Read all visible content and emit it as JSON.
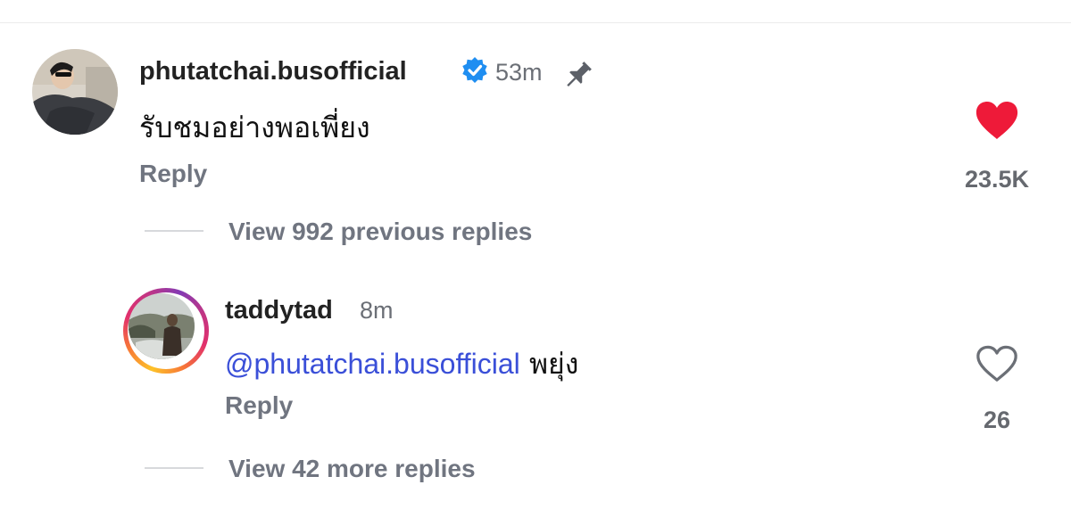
{
  "comment": {
    "username": "phutatchai.busofficial",
    "time": "53m",
    "text": "รับชมอย่างพอเพี่ยง",
    "reply_label": "Reply",
    "like_count": "23.5K",
    "liked": true,
    "verified": true,
    "pinned": true,
    "icons": [
      "verified-badge-icon",
      "pin-icon",
      "heart-filled-icon"
    ],
    "colors": {
      "heart": "#ee1a39",
      "verified": "#1f8ef1"
    }
  },
  "previous_replies": {
    "label": "View 992 previous replies"
  },
  "reply": {
    "username": "taddytad",
    "time": "8m",
    "mention": "@phutatchai.busofficial",
    "text": "พยุ่ง",
    "reply_label": "Reply",
    "like_count": "26",
    "liked": false,
    "icons": [
      "heart-outline-icon"
    ],
    "colors": {
      "mention": "#3a4fd8"
    }
  },
  "more_replies": {
    "label": "View 42 more replies"
  }
}
